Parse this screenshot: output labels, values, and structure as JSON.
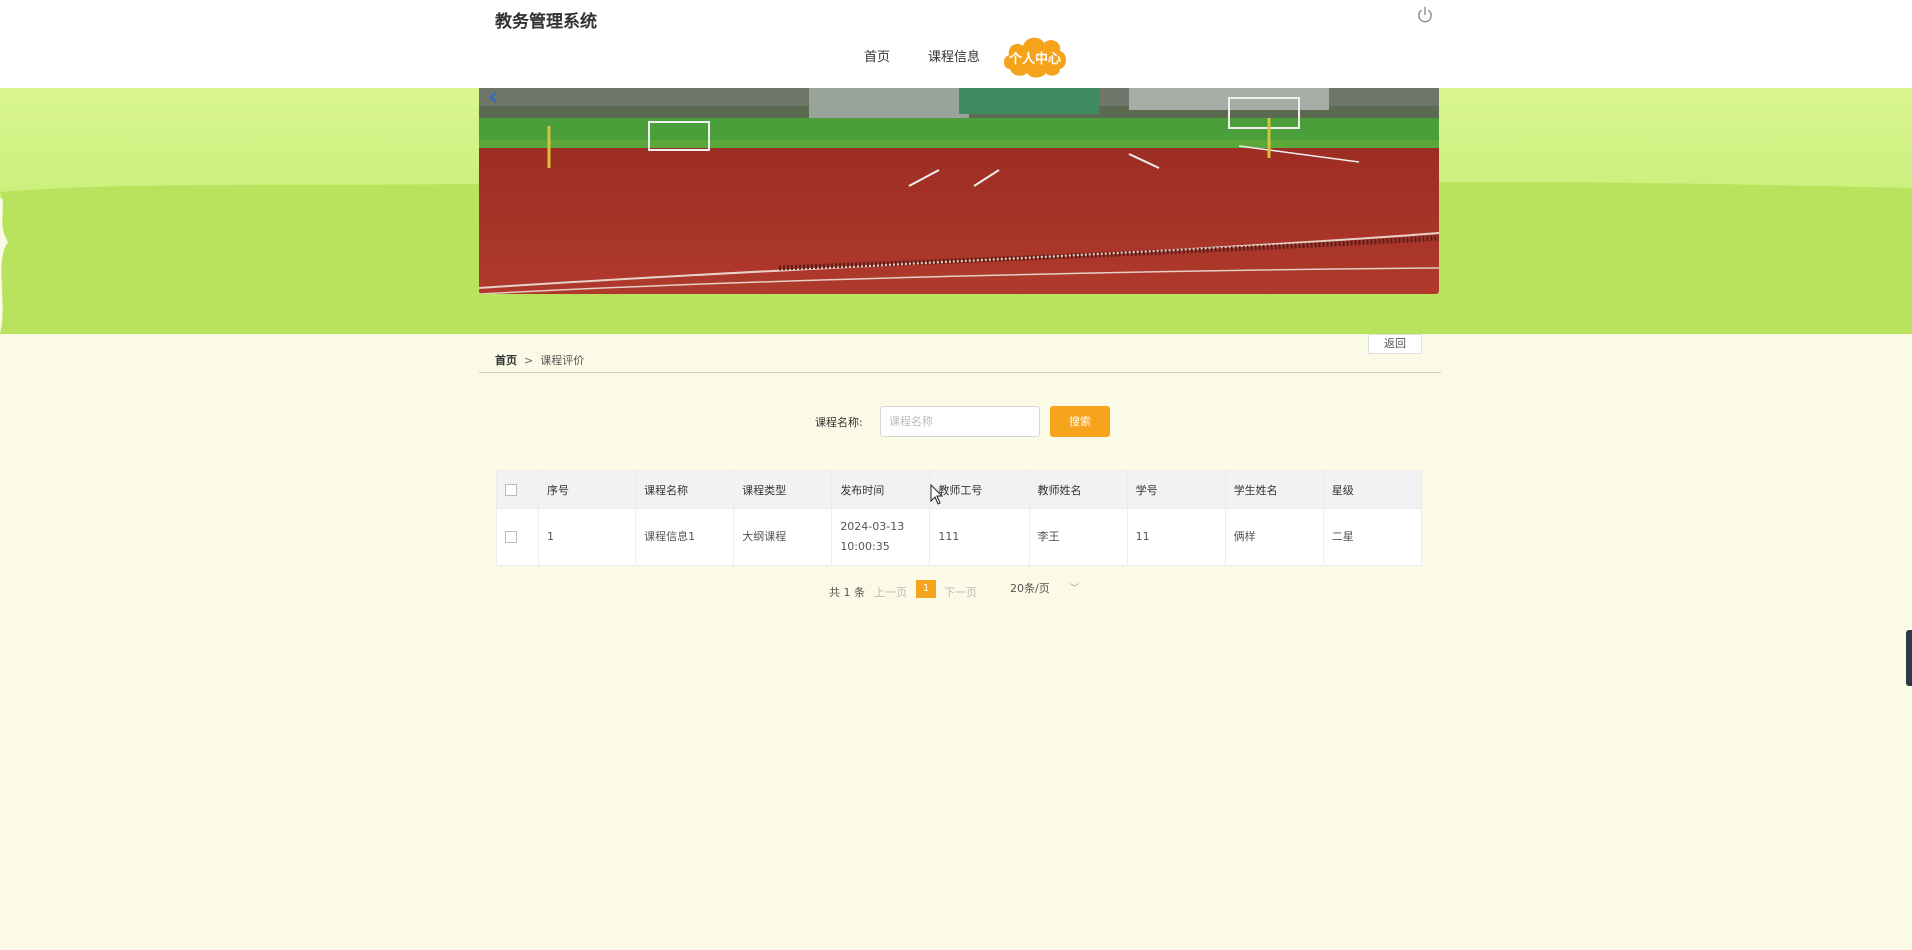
{
  "header": {
    "app_title": "教务管理系统",
    "nav": [
      {
        "label": "首页"
      },
      {
        "label": "课程信息"
      },
      {
        "label": "个人中心",
        "active": true
      }
    ]
  },
  "breadcrumb": {
    "home": "首页",
    "separator": ">",
    "current": "课程评价",
    "back_label": "返回"
  },
  "search": {
    "label": "课程名称:",
    "placeholder": "课程名称",
    "value": "",
    "button_label": "搜索"
  },
  "table": {
    "columns": [
      "序号",
      "课程名称",
      "课程类型",
      "发布时间",
      "教师工号",
      "教师姓名",
      "学号",
      "学生姓名",
      "星级"
    ],
    "rows": [
      {
        "index": "1",
        "course_name": "课程信息1",
        "course_type": "大纲课程",
        "publish_time": "2024-03-13 10:00:35",
        "teacher_id": "111",
        "teacher_name": "李王",
        "student_id": "11",
        "student_name": "俩样",
        "rating": "二星"
      }
    ]
  },
  "pagination": {
    "total_label": "共 1 条",
    "prev_label": "上一页",
    "current_page": "1",
    "next_label": "下一页",
    "page_size_label": "20条/页"
  },
  "colors": {
    "accent": "#f5a31b",
    "page_bg": "#fbfae6",
    "band_green": "#b9e35d",
    "band_light": "#d9f590"
  },
  "icons": {
    "power": "power-icon",
    "banner_prev": "chevron-left-icon",
    "page_size_dropdown": "chevron-down-icon"
  }
}
